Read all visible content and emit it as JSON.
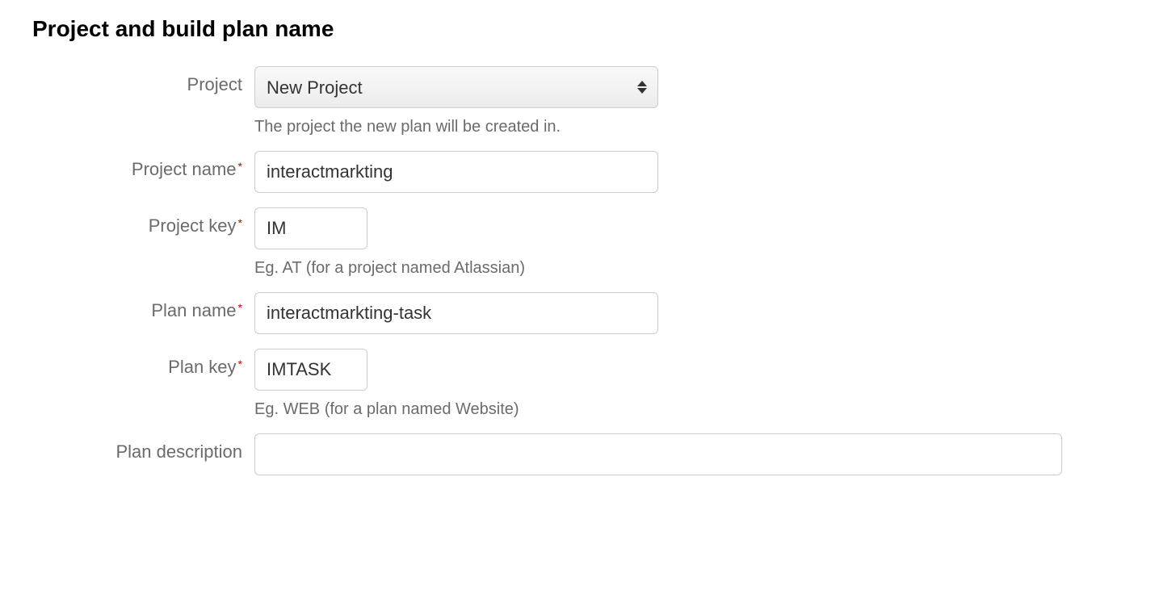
{
  "title": "Project and build plan name",
  "fields": {
    "project": {
      "label": "Project",
      "selected": "New Project",
      "help": "The project the new plan will be created in."
    },
    "projectName": {
      "label": "Project name",
      "value": "interactmarkting"
    },
    "projectKey": {
      "label": "Project key",
      "value": "IM",
      "help": "Eg. AT (for a project named Atlassian)"
    },
    "planName": {
      "label": "Plan name",
      "value": "interactmarkting-task"
    },
    "planKey": {
      "label": "Plan key",
      "value": "IMTASK",
      "help": "Eg. WEB (for a plan named Website)"
    },
    "planDescription": {
      "label": "Plan description",
      "value": ""
    }
  }
}
